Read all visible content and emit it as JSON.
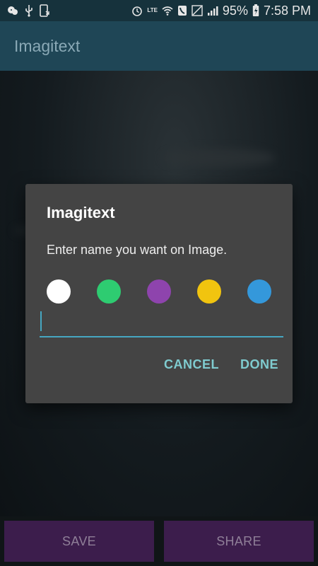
{
  "status_bar": {
    "battery": "95%",
    "time": "7:58 PM",
    "lte": "LTE"
  },
  "app_bar": {
    "title": "Imagitext"
  },
  "dialog": {
    "title": "Imagitext",
    "message": "Enter name you want on Image.",
    "input_value": "",
    "colors": [
      "#ffffff",
      "#2ecc71",
      "#8e44ad",
      "#f1c40f",
      "#3498db"
    ],
    "cancel_label": "CANCEL",
    "done_label": "DONE"
  },
  "bottom_bar": {
    "save_label": "SAVE",
    "share_label": "SHARE"
  }
}
